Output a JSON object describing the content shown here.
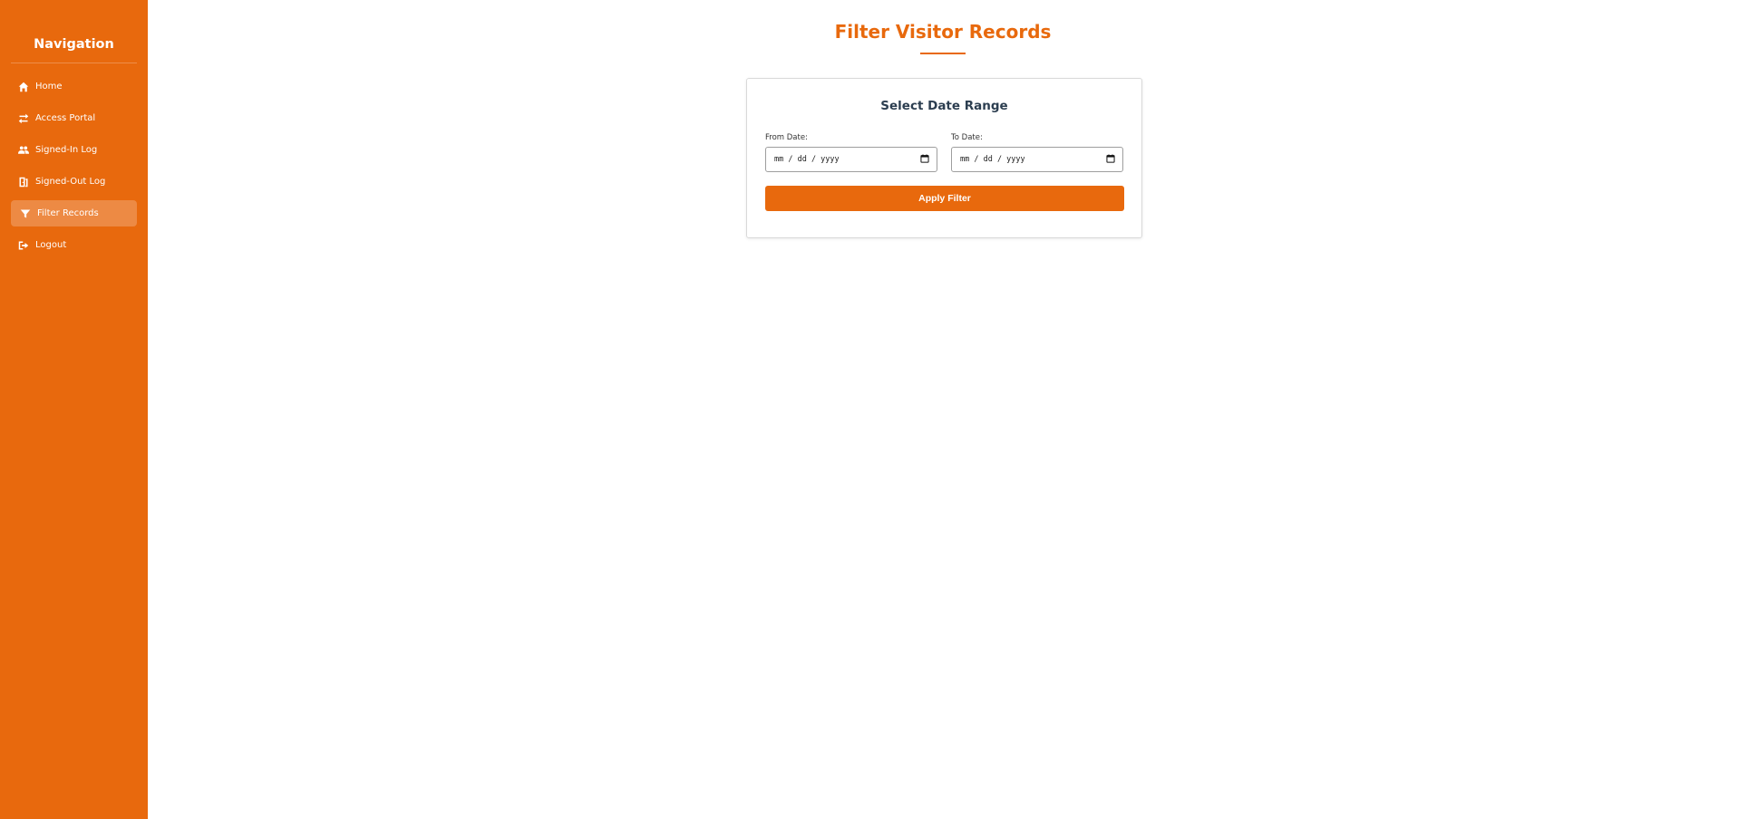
{
  "sidebar": {
    "title": "Navigation",
    "items": [
      {
        "label": "Home",
        "icon": "home-icon",
        "active": false
      },
      {
        "label": "Access Portal",
        "icon": "exchange-arrows-icon",
        "active": false
      },
      {
        "label": "Signed-In Log",
        "icon": "users-icon",
        "active": false
      },
      {
        "label": "Signed-Out Log",
        "icon": "door-exit-icon",
        "active": true
      },
      {
        "label": "Filter Records",
        "icon": "filter-icon",
        "active": true
      },
      {
        "label": "Logout",
        "icon": "logout-icon",
        "active": false
      }
    ]
  },
  "main": {
    "title": "Filter Visitor Records",
    "card": {
      "title": "Select Date Range",
      "from_label": "From Date:",
      "from_placeholder": "mm / dd / yyyy",
      "to_label": "To Date:",
      "to_placeholder": "mm / dd / yyyy",
      "apply_label": "Apply Filter"
    }
  },
  "colors": {
    "accent": "#e8690d",
    "sidebar_active": "#ed8a44",
    "card_title": "#2c3e50"
  }
}
